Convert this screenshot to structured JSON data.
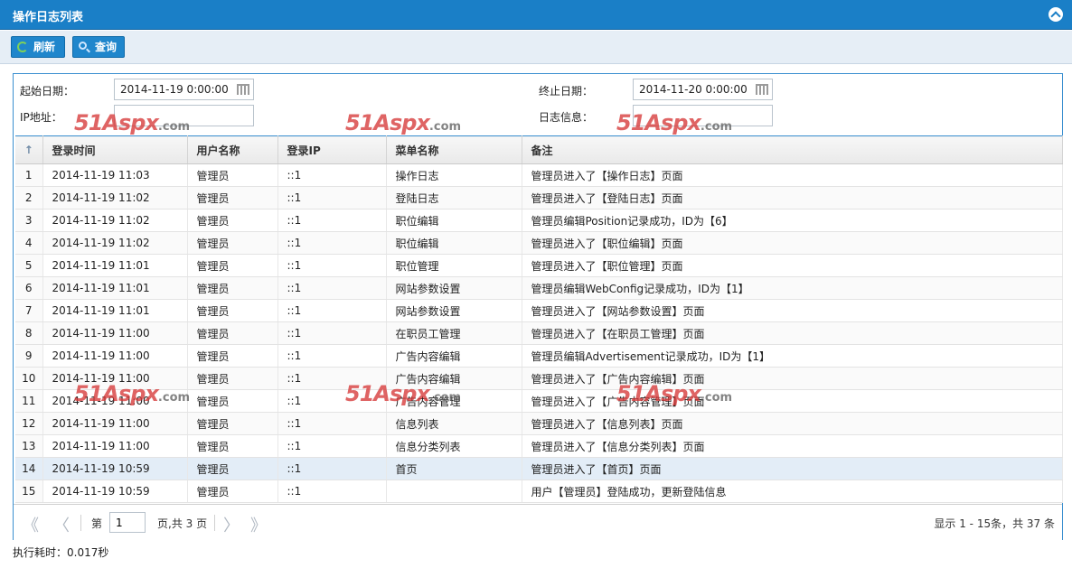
{
  "window": {
    "title": "操作日志列表"
  },
  "toolbar": {
    "refresh_label": "刷新",
    "search_label": "查询"
  },
  "filters": {
    "start_label": "起始日期：",
    "start_value": "2014-11-19 0:00:00",
    "end_label": "终止日期：",
    "end_value": "2014-11-20 0:00:00",
    "ip_label": "IP地址：",
    "ip_value": "",
    "log_label": "日志信息：",
    "log_value": ""
  },
  "table": {
    "columns": [
      "登录时间",
      "用户名称",
      "登录IP",
      "菜单名称",
      "备注"
    ],
    "rows": [
      {
        "n": "1",
        "time": "2014-11-19 11:03",
        "user": "管理员",
        "ip": "::1",
        "menu": "操作日志",
        "note": "管理员进入了【操作日志】页面"
      },
      {
        "n": "2",
        "time": "2014-11-19 11:02",
        "user": "管理员",
        "ip": "::1",
        "menu": "登陆日志",
        "note": "管理员进入了【登陆日志】页面"
      },
      {
        "n": "3",
        "time": "2014-11-19 11:02",
        "user": "管理员",
        "ip": "::1",
        "menu": "职位编辑",
        "note": "管理员编辑Position记录成功，ID为【6】"
      },
      {
        "n": "4",
        "time": "2014-11-19 11:02",
        "user": "管理员",
        "ip": "::1",
        "menu": "职位编辑",
        "note": "管理员进入了【职位编辑】页面"
      },
      {
        "n": "5",
        "time": "2014-11-19 11:01",
        "user": "管理员",
        "ip": "::1",
        "menu": "职位管理",
        "note": "管理员进入了【职位管理】页面"
      },
      {
        "n": "6",
        "time": "2014-11-19 11:01",
        "user": "管理员",
        "ip": "::1",
        "menu": "网站参数设置",
        "note": "管理员编辑WebConfig记录成功，ID为【1】"
      },
      {
        "n": "7",
        "time": "2014-11-19 11:01",
        "user": "管理员",
        "ip": "::1",
        "menu": "网站参数设置",
        "note": "管理员进入了【网站参数设置】页面"
      },
      {
        "n": "8",
        "time": "2014-11-19 11:00",
        "user": "管理员",
        "ip": "::1",
        "menu": "在职员工管理",
        "note": "管理员进入了【在职员工管理】页面"
      },
      {
        "n": "9",
        "time": "2014-11-19 11:00",
        "user": "管理员",
        "ip": "::1",
        "menu": "广告内容编辑",
        "note": "管理员编辑Advertisement记录成功，ID为【1】"
      },
      {
        "n": "10",
        "time": "2014-11-19 11:00",
        "user": "管理员",
        "ip": "::1",
        "menu": "广告内容编辑",
        "note": "管理员进入了【广告内容编辑】页面"
      },
      {
        "n": "11",
        "time": "2014-11-19 11:00",
        "user": "管理员",
        "ip": "::1",
        "menu": "广告内容管理",
        "note": "管理员进入了【广告内容管理】页面"
      },
      {
        "n": "12",
        "time": "2014-11-19 11:00",
        "user": "管理员",
        "ip": "::1",
        "menu": "信息列表",
        "note": "管理员进入了【信息列表】页面"
      },
      {
        "n": "13",
        "time": "2014-11-19 11:00",
        "user": "管理员",
        "ip": "::1",
        "menu": "信息分类列表",
        "note": "管理员进入了【信息分类列表】页面"
      },
      {
        "n": "14",
        "time": "2014-11-19 10:59",
        "user": "管理员",
        "ip": "::1",
        "menu": "首页",
        "note": "管理员进入了【首页】页面"
      },
      {
        "n": "15",
        "time": "2014-11-19 10:59",
        "user": "管理员",
        "ip": "::1",
        "menu": "",
        "note": "用户【管理员】登陆成功，更新登陆信息"
      }
    ],
    "selected_row": "14"
  },
  "pager": {
    "page_prefix": "第",
    "page_value": "1",
    "page_suffix": "页,共 3 页",
    "summary": "显示 1 - 15条，共 37 条"
  },
  "footer": {
    "exec_time": "执行耗时：0.017秒"
  },
  "watermark": {
    "brand": "51Aspx",
    "suffix": ".com"
  },
  "colors": {
    "header_blue": "#1a7fc7",
    "button_blue": "#1f86cc",
    "selected_row": "#e3edf7",
    "watermark_red": "#d63838"
  },
  "icons": {
    "collapse": "chevron-up-circle-icon",
    "refresh": "refresh-icon",
    "search": "search-icon",
    "calendar": "calendar-icon"
  }
}
